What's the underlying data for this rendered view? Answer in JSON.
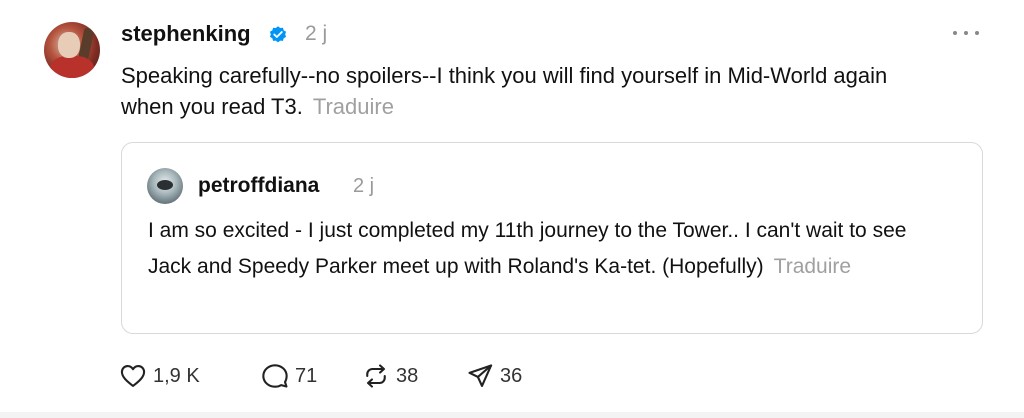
{
  "post": {
    "username": "stephenking",
    "timestamp": "2 j",
    "text": "Speaking carefully--no spoilers--I think you will find yourself in Mid-World again when you read T3.",
    "translate_label": "Traduire",
    "verified": true
  },
  "quoted_post": {
    "username": "petroffdiana",
    "timestamp": "2 j",
    "text": "I am so excited - I just completed my 11th journey to the Tower.. I can't wait to see Jack and Speedy Parker meet up with Roland's Ka-tet. (Hopefully)",
    "translate_label": "Traduire"
  },
  "actions": {
    "likes": "1,9 K",
    "replies": "71",
    "reposts": "38",
    "shares": "36"
  },
  "icons": {
    "verified": "verified-badge-icon",
    "more": "more-options-icon",
    "like": "heart-icon",
    "reply": "comment-icon",
    "repost": "repost-icon",
    "share": "send-icon"
  },
  "colors": {
    "verified_blue": "#0095f6",
    "secondary_text": "#9a9a9a"
  }
}
